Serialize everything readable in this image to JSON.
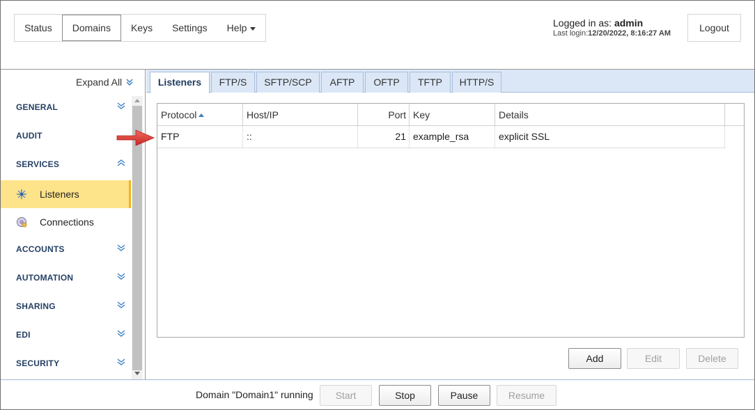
{
  "topnav": {
    "items": [
      {
        "label": "Status"
      },
      {
        "label": "Domains"
      },
      {
        "label": "Keys"
      },
      {
        "label": "Settings"
      },
      {
        "label": "Help"
      }
    ],
    "active": "Domains"
  },
  "login": {
    "prefix": "Logged in as: ",
    "user": "admin",
    "last_login_label": "Last login:",
    "last_login_value": "12/20/2022, 8:16:27 AM",
    "logout_label": "Logout"
  },
  "sidebar": {
    "expand_all_label": "Expand All",
    "sections": [
      {
        "label": "GENERAL",
        "chevron": "expand"
      },
      {
        "label": "AUDIT",
        "chevron": "none"
      },
      {
        "label": "SERVICES",
        "chevron": "collapse"
      },
      {
        "label": "ACCOUNTS",
        "chevron": "expand"
      },
      {
        "label": "AUTOMATION",
        "chevron": "expand"
      },
      {
        "label": "SHARING",
        "chevron": "expand"
      },
      {
        "label": "EDI",
        "chevron": "expand"
      },
      {
        "label": "SECURITY",
        "chevron": "expand"
      }
    ],
    "services_items": [
      {
        "label": "Listeners",
        "icon": "listeners-icon",
        "active": true
      },
      {
        "label": "Connections",
        "icon": "connections-icon",
        "active": false
      }
    ]
  },
  "tabs": [
    {
      "label": "Listeners"
    },
    {
      "label": "FTP/S"
    },
    {
      "label": "SFTP/SCP"
    },
    {
      "label": "AFTP"
    },
    {
      "label": "OFTP"
    },
    {
      "label": "TFTP"
    },
    {
      "label": "HTTP/S"
    }
  ],
  "grid": {
    "columns": [
      "Protocol",
      "Host/IP",
      "Port",
      "Key",
      "Details"
    ],
    "sorted_column": "Protocol",
    "rows": [
      {
        "protocol": "FTP",
        "host": "::",
        "port": "21",
        "key": "example_rsa",
        "details": "explicit SSL"
      }
    ]
  },
  "grid_buttons": {
    "add": "Add",
    "edit": "Edit",
    "delete": "Delete"
  },
  "footer": {
    "status": "Domain \"Domain1\" running",
    "start": "Start",
    "stop": "Stop",
    "pause": "Pause",
    "resume": "Resume"
  },
  "colors": {
    "accent": "#3b7fc4",
    "active_item_bg": "#fde38a",
    "active_item_border": "#f5b223",
    "tabbar_bg": "#dbe7f6",
    "section_text": "#243f63",
    "annotation_arrow": "#e53935"
  }
}
